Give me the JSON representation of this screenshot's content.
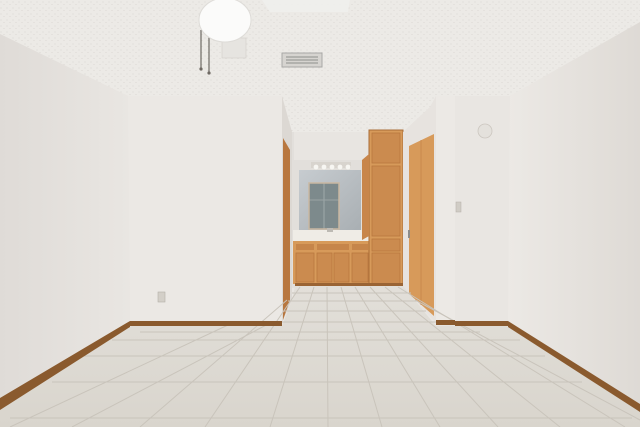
{
  "photo": {
    "subject": "",
    "palette": {
      "ceiling": "#eceae6",
      "wall_left": "#e4e0dc",
      "wall_back": "#ebe8e4",
      "wall_right": "#e6e2de",
      "floor_tile": "#dedbd4",
      "grout": "#c9c4bb",
      "wood_light": "#d79a5a",
      "wood_dark": "#b8773f",
      "baseboard": "#8a5a2e",
      "mirror": "#b9bec2",
      "window_glass": "#7d8a8c",
      "countertop": "#efece6",
      "vent": "#a8a8a6",
      "outlet": "#cfcbc4"
    }
  }
}
